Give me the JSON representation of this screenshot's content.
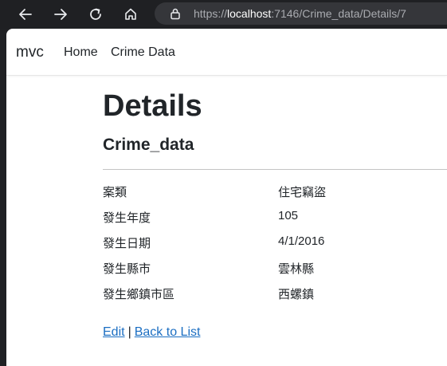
{
  "browser": {
    "url_scheme": "https://",
    "url_host": "localhost",
    "url_rest": ":7146/Crime_data/Details/7"
  },
  "navbar": {
    "brand": "mvc",
    "links": [
      "Home",
      "Crime Data"
    ]
  },
  "page": {
    "title": "Details",
    "subtitle": "Crime_data",
    "fields": [
      {
        "label": "案類",
        "value": "住宅竊盜"
      },
      {
        "label": "發生年度",
        "value": "105"
      },
      {
        "label": "發生日期",
        "value": "4/1/2016"
      },
      {
        "label": "發生縣市",
        "value": "雲林縣"
      },
      {
        "label": "發生鄉鎮市區",
        "value": "西螺鎮"
      }
    ],
    "actions": {
      "edit": "Edit",
      "separator": "|",
      "back": "Back to List"
    }
  },
  "colors": {
    "link": "#1b6ec2",
    "text": "#212529",
    "browser_bg": "#202124"
  },
  "icons": [
    "back-arrow-icon",
    "forward-arrow-icon",
    "reload-icon",
    "home-icon",
    "site-info-icon"
  ]
}
